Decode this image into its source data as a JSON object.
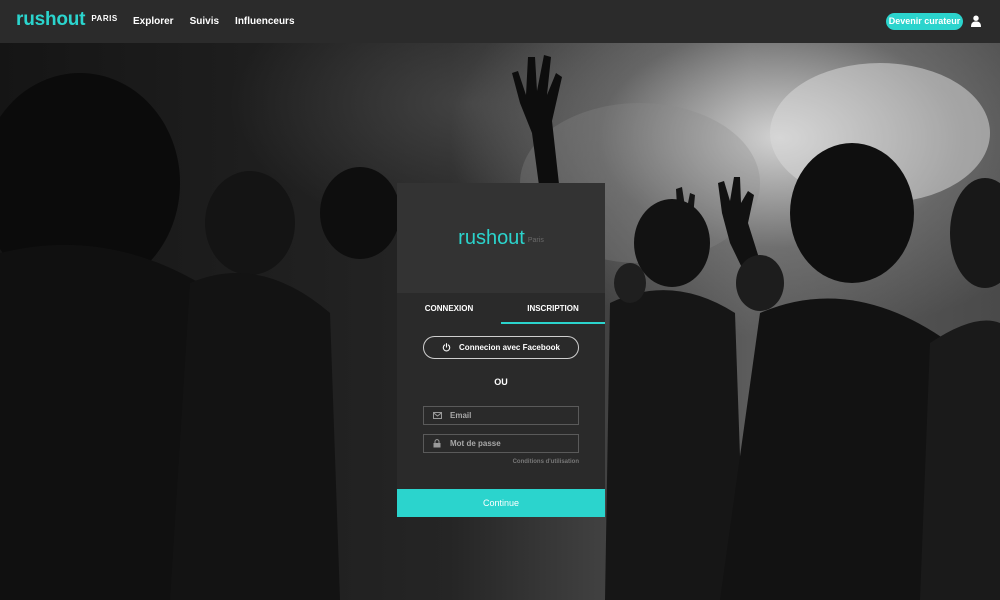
{
  "header": {
    "brand": "rushout",
    "city": "PARIS",
    "nav": [
      "Explorer",
      "Suivis",
      "Influenceurs"
    ],
    "cta_label": "Devenir curateur",
    "user_icon": "user-icon"
  },
  "modal": {
    "logo": "rushout",
    "logo_city": "Paris",
    "tabs": [
      "CONNEXION",
      "INSCRIPTION"
    ],
    "active_tab": "INSCRIPTION",
    "facebook_label": "Connecion avec Facebook",
    "facebook_icon": "power-icon",
    "or_label": "OU",
    "email": {
      "placeholder": "Email",
      "value": "",
      "icon": "mail-icon"
    },
    "password": {
      "placeholder": "Mot de passe",
      "value": "",
      "icon": "lock-icon"
    },
    "terms_label": "Conditions d'utilisation",
    "continue_label": "Continue"
  },
  "colors": {
    "accent": "#2bd4cd",
    "topbar": "#2b2b2b",
    "modal_bg": "#2a2a2a",
    "modal_header": "#333333"
  }
}
